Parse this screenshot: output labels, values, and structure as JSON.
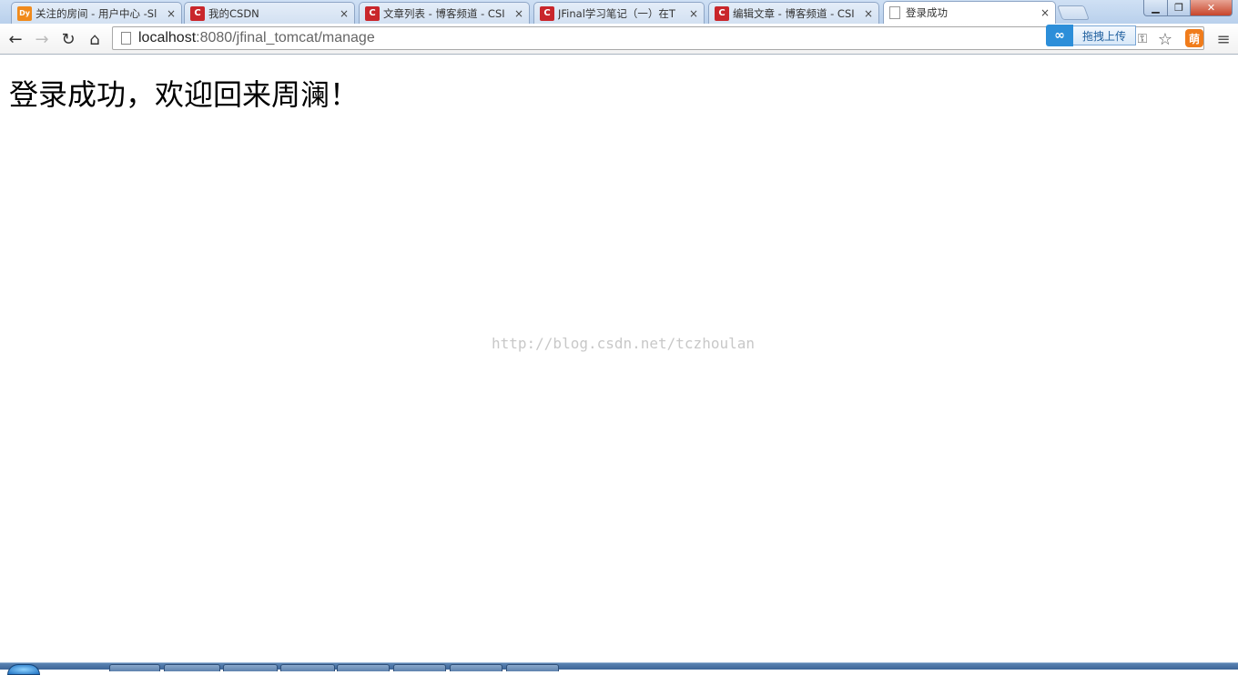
{
  "browser": {
    "tabs": [
      {
        "title": "关注的房间 - 用户中心 -Sl",
        "favicon": "douyu-icon",
        "active": false
      },
      {
        "title": "我的CSDN",
        "favicon": "csdn-icon",
        "active": false
      },
      {
        "title": "文章列表 - 博客频道 - CSI",
        "favicon": "csdn-icon",
        "active": false
      },
      {
        "title": "JFinal学习笔记（一）在T",
        "favicon": "csdn-icon",
        "active": false
      },
      {
        "title": "编辑文章 - 博客频道 - CSI",
        "favicon": "csdn-icon",
        "active": false
      },
      {
        "title": "登录成功",
        "favicon": "page-icon",
        "active": true
      }
    ],
    "close_glyph": "×",
    "favicon_letters": {
      "douyu": "Dy",
      "csdn": "C"
    },
    "window_controls": {
      "minimize": "▁",
      "maximize": "❐",
      "close": "✕"
    },
    "toolbar": {
      "back": "←",
      "forward": "→",
      "reload": "↻",
      "home": "⌂"
    },
    "address": {
      "host": "localhost",
      "rest": ":8080/jfinal_tomcat/manage"
    },
    "upload_badge": {
      "label": "拖拽上传",
      "icon": "∞"
    },
    "right_icons": {
      "key": "⚿",
      "star": "☆",
      "ext": "萌",
      "menu": "≡"
    }
  },
  "page": {
    "heading": "登录成功，欢迎回来周澜！",
    "watermark": "http://blog.csdn.net/tczhoulan"
  }
}
